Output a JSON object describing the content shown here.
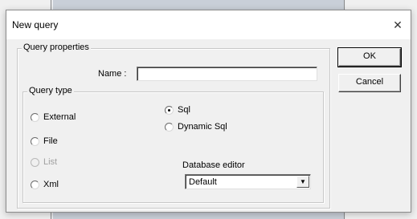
{
  "dialog": {
    "title": "New query",
    "close_symbol": "✕"
  },
  "query_properties": {
    "legend": "Query properties",
    "name_label": "Name :",
    "name_value": ""
  },
  "query_type": {
    "legend": "Query type",
    "options": [
      {
        "label": "External",
        "checked": false,
        "disabled": false
      },
      {
        "label": "File",
        "checked": false,
        "disabled": false
      },
      {
        "label": "List",
        "checked": false,
        "disabled": true
      },
      {
        "label": "Xml",
        "checked": false,
        "disabled": false
      },
      {
        "label": "Sql",
        "checked": true,
        "disabled": false
      },
      {
        "label": "Dynamic Sql",
        "checked": false,
        "disabled": false
      }
    ]
  },
  "database_editor": {
    "label": "Database editor",
    "selected": "Default",
    "arrow_icon": "▼"
  },
  "buttons": {
    "ok": "OK",
    "cancel": "Cancel"
  }
}
